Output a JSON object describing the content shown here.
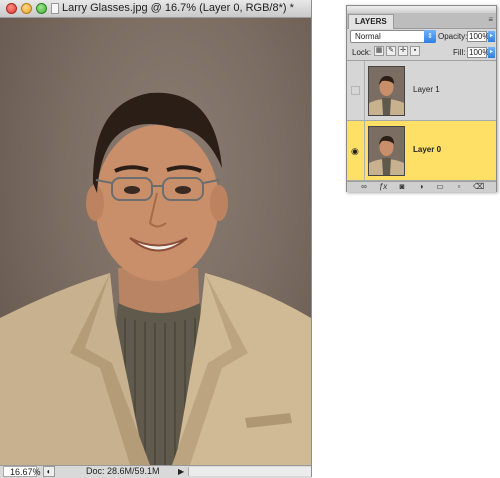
{
  "document": {
    "title": "Larry Glasses.jpg @ 16.7% (Layer 0, RGB/8*) *",
    "zoom": "16.67%",
    "doc_info": "Doc: 28.6M/59.1M"
  },
  "layers_panel": {
    "tab_label": "LAYERS",
    "blend_mode": "Normal",
    "opacity_label": "Opacity:",
    "opacity_value": "100%",
    "lock_label": "Lock:",
    "fill_label": "Fill:",
    "fill_value": "100%",
    "layers": [
      {
        "name": "Layer 1",
        "visible": false,
        "selected": false
      },
      {
        "name": "Layer 0",
        "visible": true,
        "selected": true
      }
    ],
    "bottom_icons": [
      "link-icon",
      "fx-icon",
      "mask-icon",
      "adjustment-icon",
      "group-icon",
      "new-layer-icon",
      "trash-icon"
    ]
  },
  "colors": {
    "selected_layer": "#ffe067",
    "backdrop": "#7b6d62"
  }
}
